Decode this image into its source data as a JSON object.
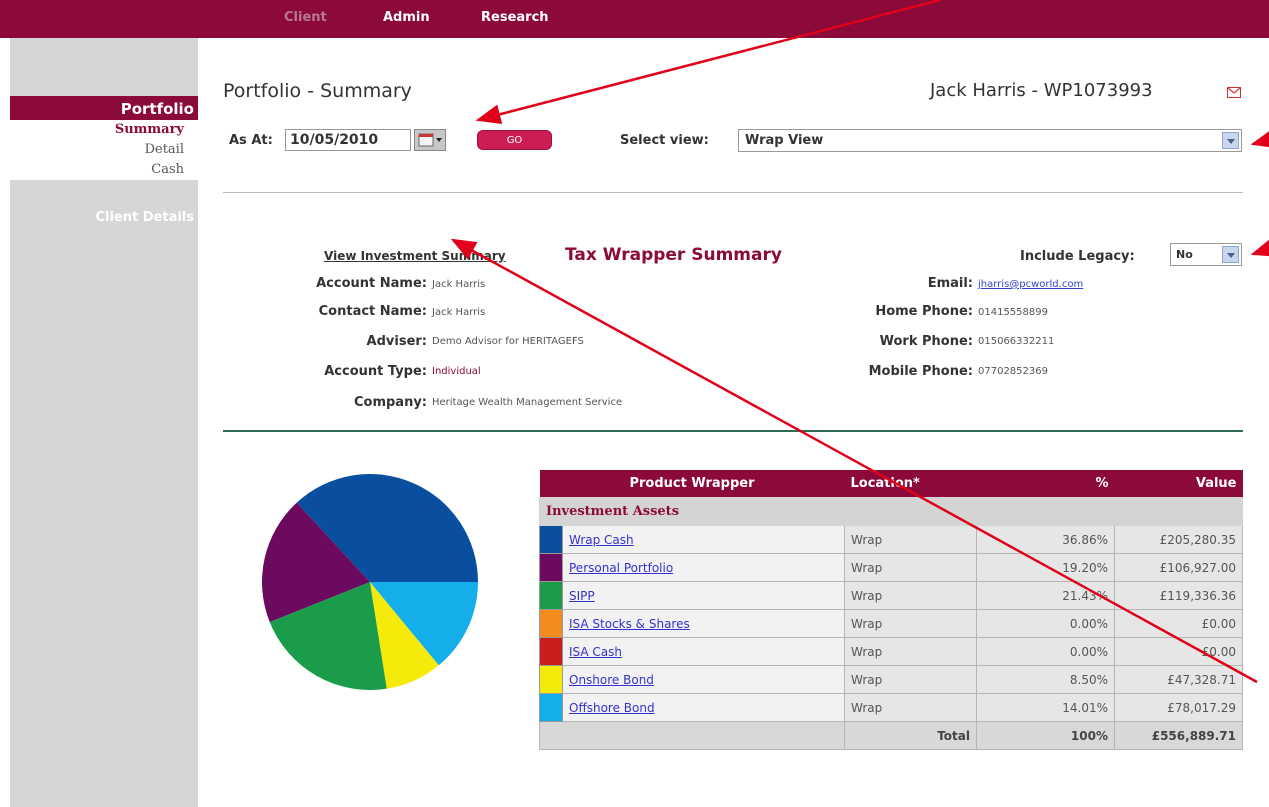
{
  "topnav": {
    "client": "Client",
    "admin": "Admin",
    "research": "Research"
  },
  "sidebar": {
    "portfolio": "Portfolio",
    "items": [
      "Summary",
      "Detail",
      "Cash"
    ],
    "client_details": "Client Details"
  },
  "header": {
    "title": "Portfolio - Summary",
    "client": "Jack Harris - WP1073993"
  },
  "toolbar": {
    "as_at_label": "As At:",
    "date_value": "10/05/2010",
    "go_label": "GO",
    "view_label": "Select view:",
    "view_value": "Wrap View"
  },
  "summary_links": {
    "investment": "View Investment Summary",
    "tax_wrapper": "Tax Wrapper Summary",
    "legacy_label": "Include Legacy:",
    "legacy_value": "No"
  },
  "details_left": [
    {
      "label": "Account Name:",
      "value": "Jack Harris"
    },
    {
      "label": "Contact Name:",
      "value": "Jack Harris"
    },
    {
      "label": "Adviser:",
      "value": "Demo Advisor for HERITAGEFS"
    },
    {
      "label": "Account Type:",
      "value": "Individual"
    },
    {
      "label": "Company:",
      "value": "Heritage Wealth Management Service"
    }
  ],
  "details_right": [
    {
      "label": "Email:",
      "value": "jharris@pcworld.com"
    },
    {
      "label": "Home Phone:",
      "value": "01415558899"
    },
    {
      "label": "Work Phone:",
      "value": "015066332211"
    },
    {
      "label": "Mobile Phone:",
      "value": "07702852369"
    }
  ],
  "table": {
    "headers": [
      "Product Wrapper",
      "Location*",
      "%",
      "Value"
    ],
    "group": "Investment Assets",
    "rows": [
      {
        "name": "Wrap Cash",
        "location": "Wrap",
        "pct": "36.86%",
        "value": "£205,280.35",
        "color": "#0a4ea0"
      },
      {
        "name": "Personal Portfolio",
        "location": "Wrap",
        "pct": "19.20%",
        "value": "£106,927.00",
        "color": "#6b0a5e"
      },
      {
        "name": "SIPP",
        "location": "Wrap",
        "pct": "21.43%",
        "value": "£119,336.36",
        "color": "#1a9c4a"
      },
      {
        "name": "ISA Stocks & Shares",
        "location": "Wrap",
        "pct": "0.00%",
        "value": "£0.00",
        "color": "#f28c1e"
      },
      {
        "name": "ISA Cash",
        "location": "Wrap",
        "pct": "0.00%",
        "value": "£0.00",
        "color": "#c81e1e"
      },
      {
        "name": "Onshore Bond",
        "location": "Wrap",
        "pct": "8.50%",
        "value": "£47,328.71",
        "color": "#f5ea0a"
      },
      {
        "name": "Offshore Bond",
        "location": "Wrap",
        "pct": "14.01%",
        "value": "£78,017.29",
        "color": "#14aeea"
      }
    ],
    "total_label": "Total",
    "total_pct": "100%",
    "total_value": "£556,889.71"
  },
  "chart_data": {
    "type": "pie",
    "categories": [
      "Wrap Cash",
      "Personal Portfolio",
      "SIPP",
      "ISA Stocks & Shares",
      "ISA Cash",
      "Onshore Bond",
      "Offshore Bond"
    ],
    "values": [
      36.86,
      19.2,
      21.43,
      0.0,
      0.0,
      8.5,
      14.01
    ],
    "colors": [
      "#0a4ea0",
      "#6b0a5e",
      "#1a9c4a",
      "#f28c1e",
      "#c81e1e",
      "#f5ea0a",
      "#14aeea"
    ]
  }
}
